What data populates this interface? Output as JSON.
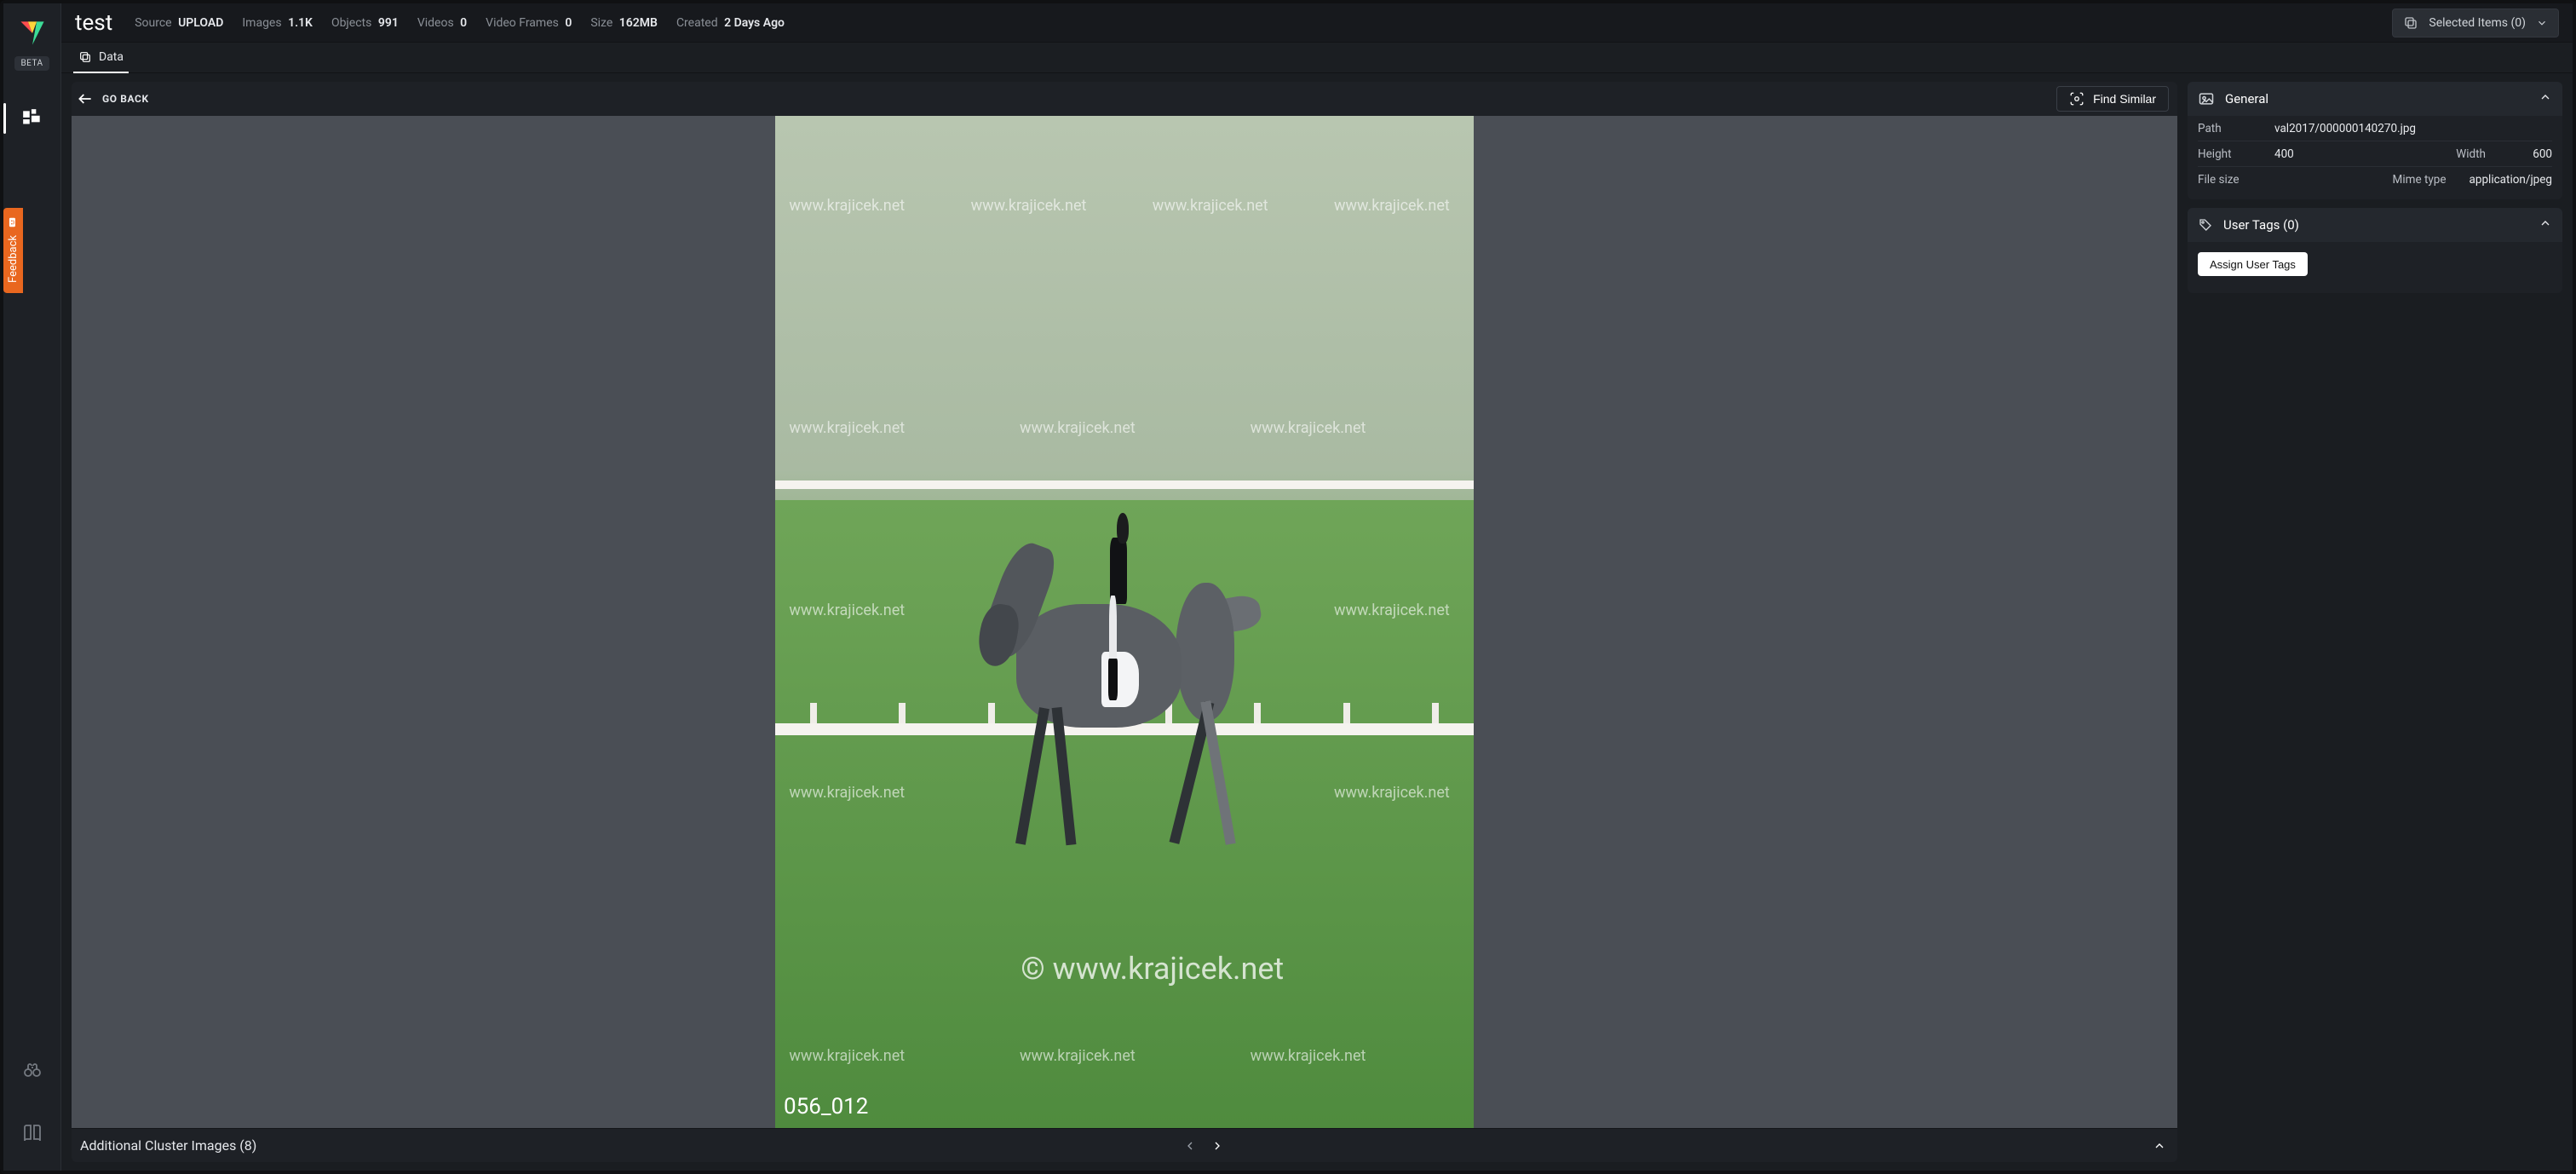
{
  "sidebar": {
    "beta_label": "BETA"
  },
  "feedback": {
    "label": "Feedback"
  },
  "dataset": {
    "name": "test",
    "meta": {
      "source_label": "Source",
      "source_value": "UPLOAD",
      "images_label": "Images",
      "images_value": "1.1K",
      "objects_label": "Objects",
      "objects_value": "991",
      "videos_label": "Videos",
      "videos_value": "0",
      "frames_label": "Video Frames",
      "frames_value": "0",
      "size_label": "Size",
      "size_value": "162MB",
      "created_label": "Created",
      "created_value": "2 Days Ago"
    },
    "selected_items_label": "Selected Items (0)"
  },
  "tabs": {
    "data_label": "Data"
  },
  "viewer": {
    "go_back_label": "GO BACK",
    "find_similar_label": "Find Similar",
    "watermark_text": "www.krajicek.net",
    "watermark_big": "© www.krajicek.net",
    "frame_label": "056_012",
    "cluster_label": "Additional Cluster Images (8)"
  },
  "details": {
    "general": {
      "title": "General",
      "path_label": "Path",
      "path_value": "val2017/000000140270.jpg",
      "height_label": "Height",
      "height_value": "400",
      "width_label": "Width",
      "width_value": "600",
      "filesize_label": "File size",
      "filesize_value": "",
      "mime_label": "Mime type",
      "mime_value": "application/jpeg"
    },
    "tags": {
      "title": "User Tags (0)",
      "assign_label": "Assign User Tags"
    }
  }
}
